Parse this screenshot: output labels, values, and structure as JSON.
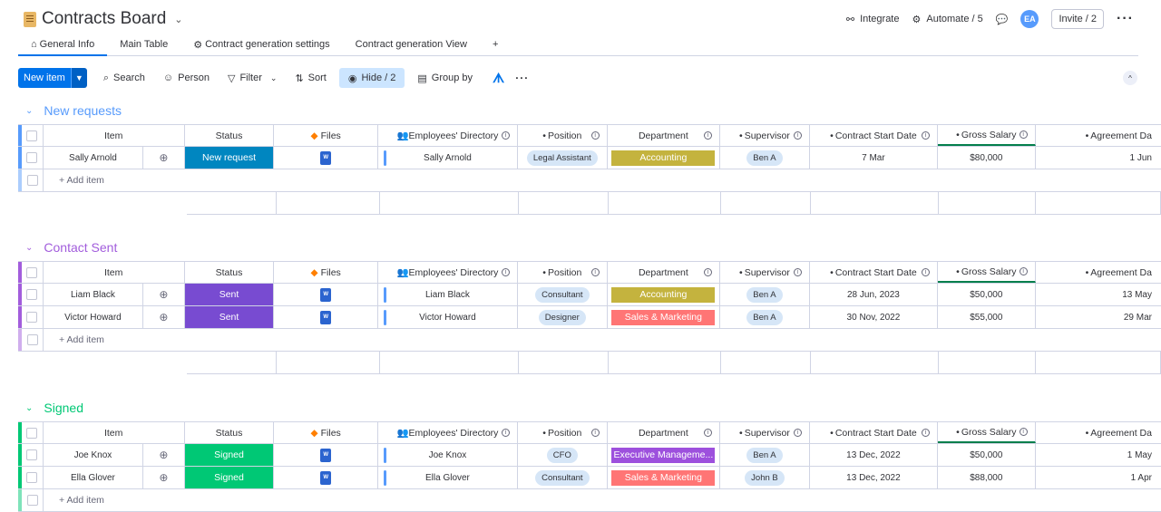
{
  "board": {
    "title": "Contracts Board"
  },
  "header": {
    "integrate": "Integrate",
    "automate": "Automate / 5",
    "avatar": "EA",
    "invite": "Invite / 2"
  },
  "tabs": [
    "General Info",
    "Main Table",
    "Contract generation settings",
    "Contract generation View",
    "+"
  ],
  "toolbar": {
    "new_item": "New item",
    "search": "Search",
    "person": "Person",
    "filter": "Filter",
    "sort": "Sort",
    "hide": "Hide / 2",
    "group_by": "Group by"
  },
  "columns": {
    "item": "Item",
    "status": "Status",
    "files": "Files",
    "emp": "Employees' Directory",
    "position": "Position",
    "department": "Department",
    "supervisor": "Supervisor",
    "csd": "Contract Start Date",
    "gs": "Gross Salary",
    "agr": "Agreement Da"
  },
  "colors": {
    "new_requests": "#579bfc",
    "contact_sent": "#a25ddc",
    "signed": "#00c875",
    "new_request_status": "#0086c0",
    "sent_status": "#784bd1",
    "signed_status": "#00c875",
    "accounting": "#c4b33e",
    "sales": "#ff7575",
    "exec": "#9d50dd"
  },
  "add_item": "+ Add item",
  "groups": [
    {
      "name": "New requests",
      "rows": [
        {
          "item": "Sally Arnold",
          "status": "New request",
          "emp": "Sally Arnold",
          "position": "Legal Assistant",
          "department": "Accounting",
          "supervisor": "Ben A",
          "csd": "7 Mar",
          "gs": "$80,000",
          "agr": "1 Jun"
        }
      ]
    },
    {
      "name": "Contact Sent",
      "rows": [
        {
          "item": "Liam Black",
          "status": "Sent",
          "emp": "Liam Black",
          "position": "Consultant",
          "department": "Accounting",
          "supervisor": "Ben A",
          "csd": "28 Jun, 2023",
          "gs": "$50,000",
          "agr": "13 May"
        },
        {
          "item": "Victor Howard",
          "status": "Sent",
          "emp": "Victor Howard",
          "position": "Designer",
          "department": "Sales & Marketing",
          "supervisor": "Ben A",
          "csd": "30 Nov, 2022",
          "gs": "$55,000",
          "agr": "29 Mar"
        }
      ]
    },
    {
      "name": "Signed",
      "rows": [
        {
          "item": "Joe Knox",
          "status": "Signed",
          "emp": "Joe Knox",
          "position": "CFO",
          "department": "Executive Manageme...",
          "supervisor": "Ben A",
          "csd": "13 Dec, 2022",
          "gs": "$50,000",
          "agr": "1 May"
        },
        {
          "item": "Ella Glover",
          "status": "Signed",
          "emp": "Ella Glover",
          "position": "Consultant",
          "department": "Sales & Marketing",
          "supervisor": "John B",
          "csd": "13 Dec, 2022",
          "gs": "$88,000",
          "agr": "1 Apr"
        }
      ]
    }
  ]
}
